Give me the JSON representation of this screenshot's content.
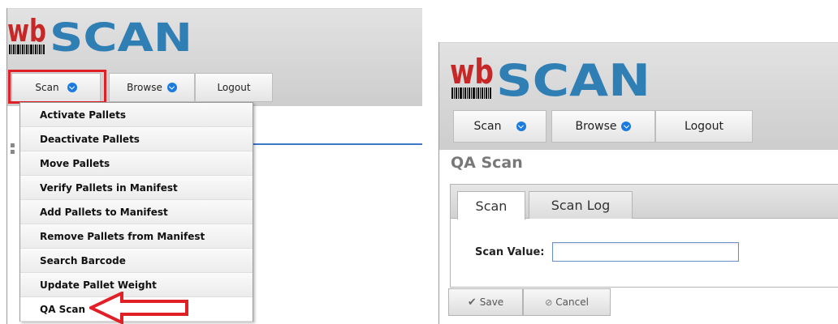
{
  "logo": {
    "prefix": "wb",
    "word": "SCAN"
  },
  "colors": {
    "logo_wb": "#c62828",
    "logo_scan": "#2f7fb4",
    "accent_blue": "#1a7be0",
    "highlight_red": "#e01f26"
  },
  "left": {
    "nav": {
      "scan_label": "Scan",
      "browse_label": "Browse",
      "logout_label": "Logout"
    },
    "menu_items": [
      "Activate Pallets",
      "Deactivate Pallets",
      "Move Pallets",
      "Verify Pallets in Manifest",
      "Add Pallets to Manifest",
      "Remove Pallets from Manifest",
      "Search Barcode",
      "Update Pallet Weight",
      "QA Scan"
    ]
  },
  "right": {
    "nav": {
      "scan_label": "Scan",
      "browse_label": "Browse",
      "logout_label": "Logout"
    },
    "page_title": "QA Scan",
    "tabs": [
      "Scan",
      "Scan Log"
    ],
    "active_tab": "Scan",
    "scan_value_label": "Scan Value:",
    "scan_value": "",
    "save_label": "Save",
    "cancel_label": "Cancel",
    "save_icon": "checkmark-icon",
    "cancel_icon": "cancel-icon"
  }
}
